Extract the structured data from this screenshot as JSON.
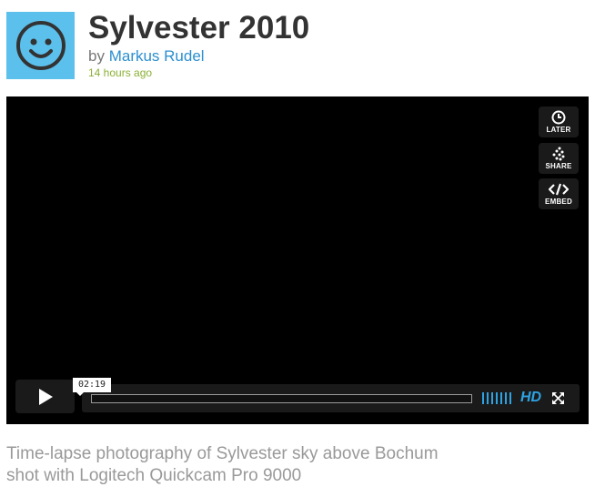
{
  "video": {
    "title": "Sylvester 2010",
    "byline_prefix": "by",
    "author": "Markus Rudel",
    "posted": "14 hours ago",
    "description_lines": [
      "Time-lapse photography of Sylvester sky above Bochum",
      "shot with Logitech Quickcam Pro 9000"
    ]
  },
  "avatar": {
    "icon": "smiley-face-icon",
    "background": "#5cc0ec"
  },
  "player": {
    "side_buttons": [
      {
        "label": "LATER",
        "icon": "clock-icon"
      },
      {
        "label": "SHARE",
        "icon": "share-icon"
      },
      {
        "label": "EMBED",
        "icon": "embed-code-icon"
      }
    ],
    "play_icon": "play-icon",
    "time": "02:19",
    "hd_label": "HD",
    "fullscreen_icon": "fullscreen-icon",
    "progress_fraction": 0
  },
  "colors": {
    "link": "#2b8fcf",
    "timestamp": "#8bb035",
    "accent": "#2ea3e3",
    "player_bg": "#000000"
  }
}
